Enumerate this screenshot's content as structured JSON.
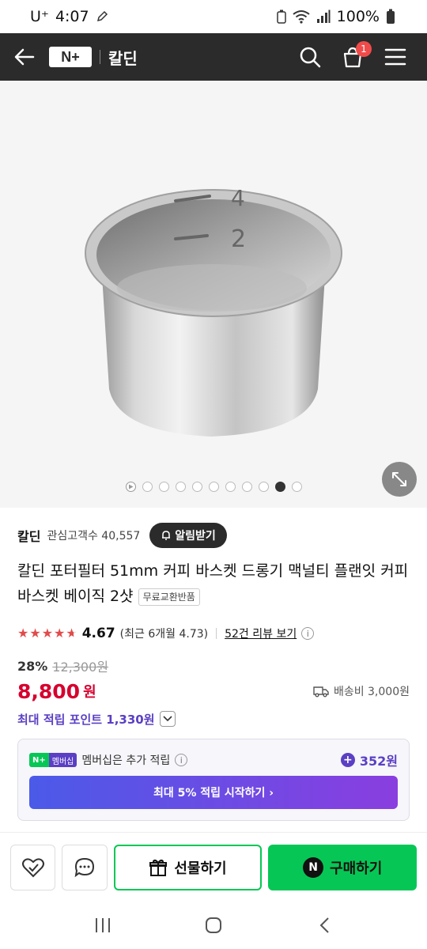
{
  "status_bar": {
    "carrier": "U⁺",
    "time": "4:07",
    "battery": "100%"
  },
  "app_bar": {
    "logo": "N+",
    "store_name": "칼딘",
    "cart_count": "1"
  },
  "gallery": {
    "image_count": 11,
    "active_index": 9
  },
  "seller": {
    "name": "칼딘",
    "followers": "관심고객수 40,557",
    "notify_label": "알림받기"
  },
  "product": {
    "title": "칼딘 포터필터 51mm 커피 바스켓 드롱기 맥널티 플랜잇 커피 바스켓 베이직 2샷",
    "return_badge": "무료교환반품",
    "rating_value": "4.67",
    "rating_stars": 4.67,
    "rating_recent": "(최근 6개월 4.73)",
    "review_link": "52건 리뷰 보기",
    "discount_pct": "28%",
    "original_price": "12,300원",
    "price": "8,800",
    "price_unit": "원",
    "shipping": "배송비 3,000원",
    "max_points": "최대 적립 포인트 1,330원"
  },
  "membership": {
    "badge_left": "N+",
    "badge_right": "멤버십",
    "text": "멤버십은 추가 적립",
    "points": "352원",
    "cta": "최대 5% 적립 시작하기 ›"
  },
  "actions": {
    "gift_label": "선물하기",
    "buy_label": "구매하기",
    "buy_badge": "N"
  },
  "colors": {
    "accent_green": "#06c755",
    "price_red": "#d6002f",
    "purple": "#5b3fc4"
  }
}
